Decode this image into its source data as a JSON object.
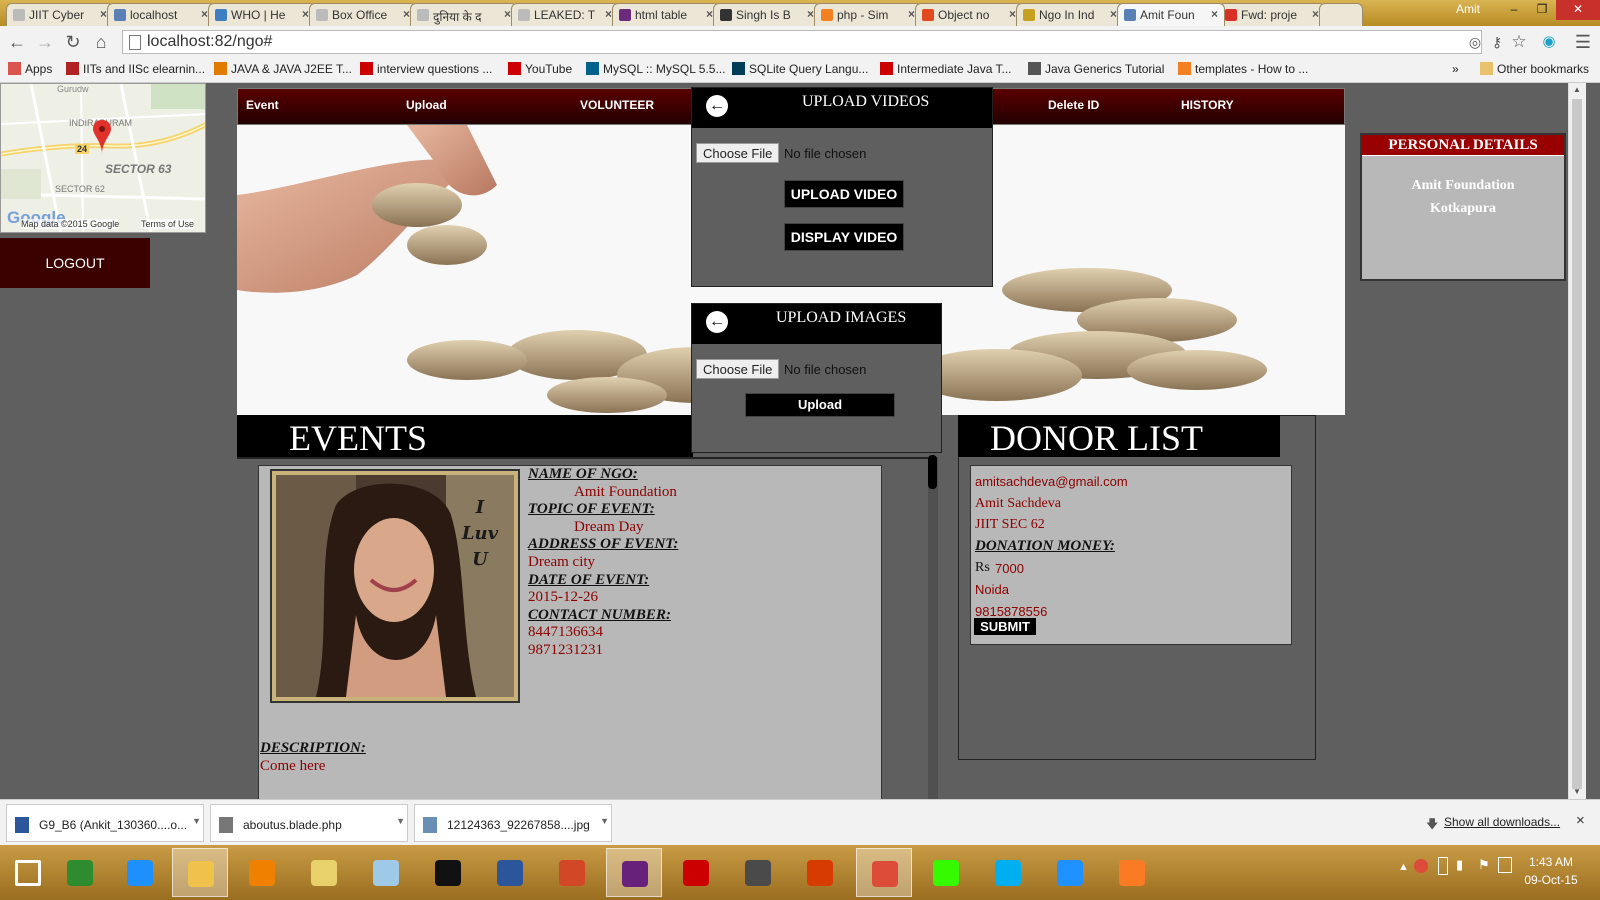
{
  "browser": {
    "tabs": [
      {
        "label": "JIIT Cyber",
        "icon_color": "#bbbbbb"
      },
      {
        "label": "localhost",
        "icon_color": "#5a7fb5"
      },
      {
        "label": "WHO | He",
        "icon_color": "#3d7fc1"
      },
      {
        "label": "Box Office",
        "icon_color": "#bbbbbb"
      },
      {
        "label": "दुनिया के द",
        "icon_color": "#bbbbbb"
      },
      {
        "label": "LEAKED: T",
        "icon_color": "#bbbbbb"
      },
      {
        "label": "html table",
        "icon_color": "#6b2b7a"
      },
      {
        "label": "Singh Is B",
        "icon_color": "#333333"
      },
      {
        "label": "php - Sim",
        "icon_color": "#f48024"
      },
      {
        "label": "Object no",
        "icon_color": "#e04a1c"
      },
      {
        "label": "Ngo In Ind",
        "icon_color": "#c8a020"
      },
      {
        "label": "Amit Foun",
        "icon_color": "#5a7fb5"
      },
      {
        "label": "Fwd: proje",
        "icon_color": "#d93025"
      }
    ],
    "user_badge": "Amit",
    "url": "localhost:82/ngo#",
    "bookmarks": [
      {
        "label": "Apps",
        "icon_color": "#d9534f"
      },
      {
        "label": "IITs and IISc elearnin...",
        "icon_color": "#b22222"
      },
      {
        "label": "JAVA & JAVA J2EE T...",
        "icon_color": "#e07b00"
      },
      {
        "label": "interview questions ...",
        "icon_color": "#cc0000"
      },
      {
        "label": "YouTube",
        "icon_color": "#cc0000"
      },
      {
        "label": "MySQL :: MySQL 5.5...",
        "icon_color": "#00618a"
      },
      {
        "label": "SQLite Query Langu...",
        "icon_color": "#003b57"
      },
      {
        "label": "Intermediate Java T...",
        "icon_color": "#cc0000"
      },
      {
        "label": "Java Generics Tutorial",
        "icon_color": "#555555"
      },
      {
        "label": "templates - How to ...",
        "icon_color": "#f48024"
      },
      {
        "label": "Other bookmarks",
        "icon_color": "#e8c26b"
      }
    ],
    "bookmarks_overflow": "»"
  },
  "map": {
    "labels": {
      "area1": "Gurudw",
      "area2": "INDIRAPURAM",
      "sector63": "SECTOR 63",
      "sector62": "SECTOR 62",
      "road": "24"
    },
    "attribution": "Map data ©2015 Google",
    "terms": "Terms of Use",
    "logo": "Google"
  },
  "sidebar": {
    "logout": "LOGOUT"
  },
  "nav": {
    "event": "Event",
    "upload": "Upload",
    "volunteer": "VOLUNTEER",
    "delete_id": "Delete ID",
    "history": "HISTORY"
  },
  "upload_videos": {
    "title": "UPLOAD VIDEOS",
    "choose": "Choose File",
    "no_file": "No file chosen",
    "upload_btn": "UPLOAD VIDEO",
    "display_btn": "DISPLAY VIDEO"
  },
  "upload_images": {
    "title": "UPLOAD IMAGES",
    "choose": "Choose File",
    "no_file": "No file chosen",
    "upload_btn": "Upload"
  },
  "personal": {
    "title": "PERSONAL DETAILS",
    "name": "Amit Foundation",
    "city": "Kotkapura"
  },
  "events": {
    "title": "EVENTS",
    "photo_caption": "I\nLuv\nU",
    "labels": {
      "ngo": "NAME OF NGO:",
      "topic": "TOPIC OF EVENT:",
      "address": "ADDRESS OF EVENT:",
      "date": "DATE OF EVENT:",
      "contact": "CONTACT NUMBER:",
      "description": "DESCRIPTION:"
    },
    "values": {
      "ngo": "Amit Foundation",
      "topic": "Dream Day",
      "address": "Dream city",
      "date": "2015-12-26",
      "contact1": "8447136634",
      "contact2": "9871231231",
      "description": "Come here"
    }
  },
  "donor": {
    "title": "DONOR LIST",
    "email": "amitsachdeva@gmail.com",
    "name": "Amit Sachdeva",
    "address": "JIIT SEC 62",
    "money_label": "DONATION MONEY:",
    "currency": "Rs",
    "amount": "7000",
    "city": "Noida",
    "phone": "9815878556",
    "submit": "SUBMIT"
  },
  "downloads": {
    "items": [
      {
        "name": "G9_B6 (Ankit_130360....o...",
        "icon_color": "#2b579a"
      },
      {
        "name": "aboutus.blade.php",
        "icon_color": "#777777"
      },
      {
        "name": "12124363_92267858....jpg",
        "icon_color": "#6a8fb5"
      }
    ],
    "show_all": "Show all downloads...",
    "close": "×"
  },
  "taskbar": {
    "apps": [
      {
        "name": "start",
        "color": "#ffffff"
      },
      {
        "name": "store",
        "color": "#2e8b2e"
      },
      {
        "name": "ie",
        "color": "#1e90ff"
      },
      {
        "name": "explorer",
        "color": "#f0c14b"
      },
      {
        "name": "vlc",
        "color": "#f08000"
      },
      {
        "name": "folder",
        "color": "#e8d16b"
      },
      {
        "name": "notepad",
        "color": "#9ecae8"
      },
      {
        "name": "cmd",
        "color": "#111111"
      },
      {
        "name": "word",
        "color": "#2b579a"
      },
      {
        "name": "powerpoint",
        "color": "#d24726"
      },
      {
        "name": "visual-studio",
        "color": "#68217a"
      },
      {
        "name": "kaspersky",
        "color": "#cc0000"
      },
      {
        "name": "sublime",
        "color": "#4a4a4a"
      },
      {
        "name": "office",
        "color": "#d83b01"
      },
      {
        "name": "chrome",
        "color": "#dd4b39"
      },
      {
        "name": "dreamweaver",
        "color": "#35fa00"
      },
      {
        "name": "skype",
        "color": "#00aff0"
      },
      {
        "name": "wifi",
        "color": "#1e90ff"
      },
      {
        "name": "xampp",
        "color": "#fb7a24"
      }
    ],
    "time": "1:43 AM",
    "date": "09-Oct-15"
  }
}
